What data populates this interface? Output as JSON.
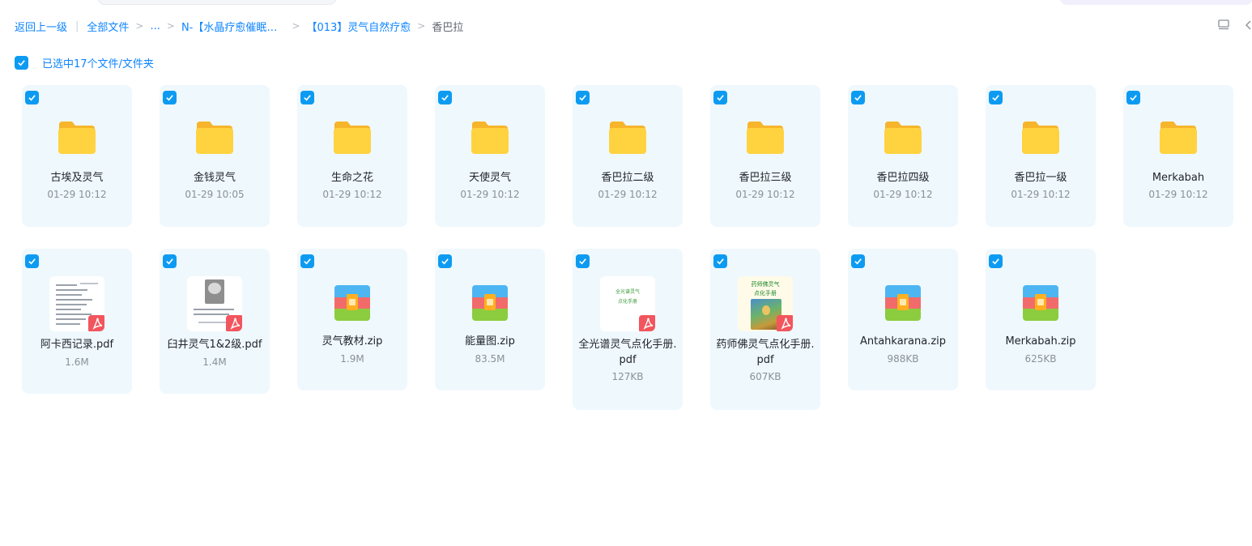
{
  "breadcrumb": {
    "back": "返回上一级",
    "all_files": "全部文件",
    "ellipsis": "...",
    "folder1": "N-【水晶疗愈催眠…",
    "folder2": "【013】灵气自然疗愈",
    "current": "香巴拉"
  },
  "selection": {
    "label": "已选中17个文件/文件夹"
  },
  "colors": {
    "accent": "#0d84ff",
    "checkbox": "#0d9bf2",
    "card_bg": "#eff8fd",
    "pdf_red": "#f2555d"
  },
  "folders": [
    {
      "name": "古埃及灵气",
      "time": "01-29 10:12"
    },
    {
      "name": "金钱灵气",
      "time": "01-29 10:05"
    },
    {
      "name": "生命之花",
      "time": "01-29 10:12"
    },
    {
      "name": "天使灵气",
      "time": "01-29 10:12"
    },
    {
      "name": "香巴拉二级",
      "time": "01-29 10:12"
    },
    {
      "name": "香巴拉三级",
      "time": "01-29 10:12"
    },
    {
      "name": "香巴拉四级",
      "time": "01-29 10:12"
    },
    {
      "name": "香巴拉一级",
      "time": "01-29 10:12"
    },
    {
      "name": "Merkabah",
      "time": "01-29 10:12"
    }
  ],
  "files": [
    {
      "name": "阿卡西记录.pdf",
      "size": "1.6M",
      "icon": "pdf-icon"
    },
    {
      "name": "臼井灵气1&2级.pdf",
      "size": "1.4M",
      "icon": "pdf-icon"
    },
    {
      "name": "灵气教材.zip",
      "size": "1.9M",
      "icon": "zip-archive-icon"
    },
    {
      "name": "能量图.zip",
      "size": "83.5M",
      "icon": "zip-archive-icon"
    },
    {
      "name": "全光谱灵气点化手册.pdf",
      "size": "127KB",
      "icon": "pdf-icon"
    },
    {
      "name": "药师佛灵气点化手册.pdf",
      "size": "607KB",
      "icon": "pdf-icon"
    },
    {
      "name": "Antahkarana.zip",
      "size": "988KB",
      "icon": "zip-archive-icon"
    },
    {
      "name": "Merkabah.zip",
      "size": "625KB",
      "icon": "zip-archive-icon"
    }
  ],
  "thumb_text": {
    "f4_line1": "全光谱灵气",
    "f4_line2": "点化手册",
    "f5_line1": "药师佛灵气",
    "f5_line2": "点化手册"
  }
}
